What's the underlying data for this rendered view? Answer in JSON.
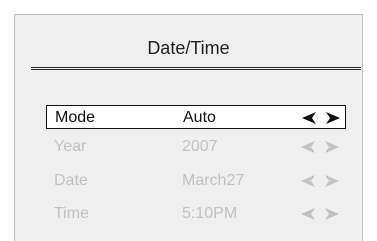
{
  "dialog": {
    "title": "Date/Time"
  },
  "settings": [
    {
      "label": "Mode",
      "value": "Auto",
      "selected": true,
      "left_icon": "left-triangle-icon",
      "right_icon": "right-triangle-icon"
    },
    {
      "label": "Year",
      "value": "2007",
      "selected": false,
      "left_icon": "left-triangle-icon",
      "right_icon": "right-triangle-icon"
    },
    {
      "label": "Date",
      "value": "March27",
      "selected": false,
      "left_icon": "left-triangle-icon",
      "right_icon": "right-triangle-icon"
    },
    {
      "label": "Time",
      "value": "5:10PM",
      "selected": false,
      "left_icon": "left-triangle-icon",
      "right_icon": "right-triangle-icon"
    }
  ],
  "colors": {
    "panel_background": "#efefef",
    "active_text": "#111111",
    "disabled_text": "#c2c2c2",
    "selected_row_background": "#ffffff"
  }
}
